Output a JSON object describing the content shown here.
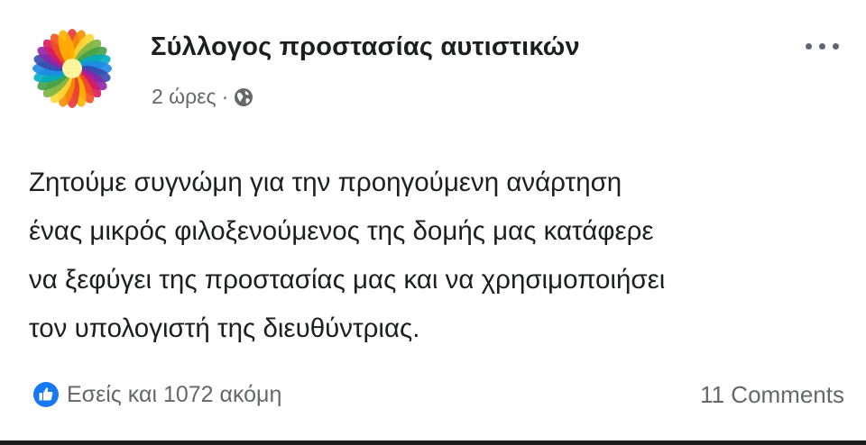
{
  "post": {
    "author": "Σύλλογος προστασίας αυτιστικών",
    "time": "2 ώρες",
    "separator": "·",
    "privacy_icon": "globe-icon",
    "more_icon": "more-horizontal-icon",
    "avatar_icon": "rainbow-flower-icon",
    "text_lines": [
      "Ζητούμε συγνώμη για την προηγούμενη ανάρτηση",
      "ένας μικρός φιλοξενούμενος της δομής μας κατάφερε",
      "να ξεφύγει της προστασίας μας και να χρησιμοποιήσει",
      "τον υπολογιστή της διευθύντριας."
    ],
    "reactions_label": "Εσείς και 1072 ακόμη",
    "reaction_icon": "like-icon",
    "comments_label": "11 Comments"
  },
  "colors": {
    "like_blue": "#1877f2",
    "secondary_text": "#65676b"
  }
}
